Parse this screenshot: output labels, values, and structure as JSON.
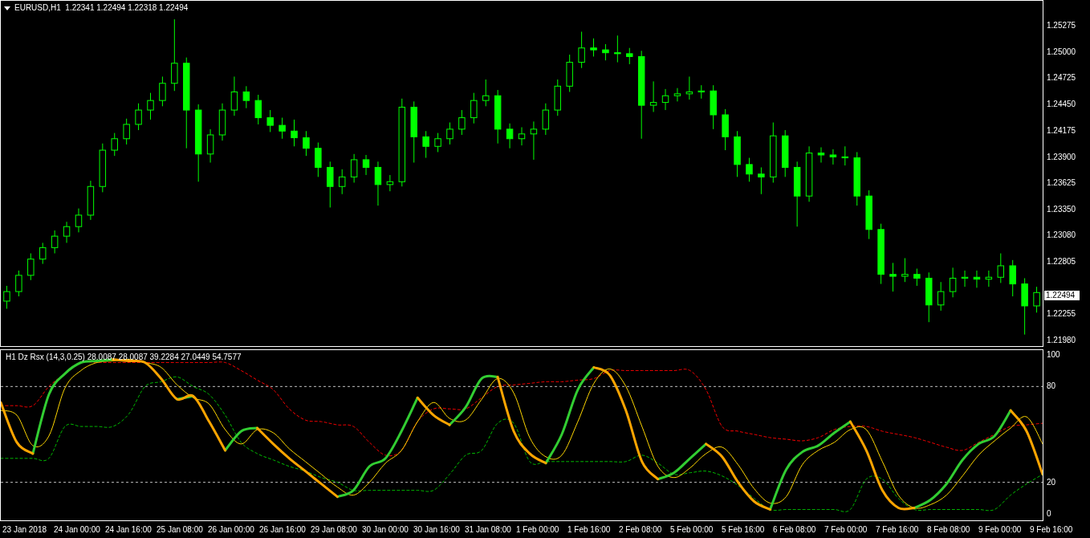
{
  "chart": {
    "title": "EURUSD,H1  1.22341 1.22494 1.22318 1.22494",
    "current_price": "1.22494",
    "chart_data": {
      "type": "candlestick",
      "ylim": [
        1.21921,
        1.25552
      ],
      "yticks": [
        {
          "value": 1.25275,
          "label": "1.25275"
        },
        {
          "value": 1.25,
          "label": "1.25000"
        },
        {
          "value": 1.24725,
          "label": "1.24725"
        },
        {
          "value": 1.2445,
          "label": "1.24450"
        },
        {
          "value": 1.24175,
          "label": "1.24175"
        },
        {
          "value": 1.239,
          "label": "1.23900"
        },
        {
          "value": 1.23625,
          "label": "1.23625"
        },
        {
          "value": 1.2335,
          "label": "1.23350"
        },
        {
          "value": 1.2308,
          "label": "1.23080"
        },
        {
          "value": 1.22805,
          "label": "1.22805"
        },
        {
          "value": 1.22255,
          "label": "1.22255"
        },
        {
          "value": 1.2198,
          "label": "1.21980"
        }
      ],
      "ohlc": [
        [
          1.224,
          1.2256,
          1.2232,
          1.225
        ],
        [
          1.225,
          1.2272,
          1.2245,
          1.2267
        ],
        [
          1.2267,
          1.229,
          1.2262,
          1.2284
        ],
        [
          1.2284,
          1.2301,
          1.2279,
          1.2296
        ],
        [
          1.2296,
          1.2314,
          1.229,
          1.2308
        ],
        [
          1.2308,
          1.2323,
          1.2301,
          1.2318
        ],
        [
          1.2318,
          1.2337,
          1.2312,
          1.233
        ],
        [
          1.233,
          1.2366,
          1.2325,
          1.236
        ],
        [
          1.236,
          1.2405,
          1.2354,
          1.2398
        ],
        [
          1.2398,
          1.2416,
          1.2392,
          1.241
        ],
        [
          1.241,
          1.2431,
          1.2404,
          1.2425
        ],
        [
          1.2425,
          1.2447,
          1.2419,
          1.244
        ],
        [
          1.244,
          1.2458,
          1.243,
          1.245
        ],
        [
          1.245,
          1.2475,
          1.2444,
          1.2468
        ],
        [
          1.2468,
          1.2535,
          1.246,
          1.2489
        ],
        [
          1.2489,
          1.2495,
          1.24,
          1.244
        ],
        [
          1.244,
          1.2446,
          1.2365,
          1.2394
        ],
        [
          1.2394,
          1.242,
          1.2385,
          1.2414
        ],
        [
          1.2414,
          1.2447,
          1.2408,
          1.244
        ],
        [
          1.244,
          1.2475,
          1.2434,
          1.2459
        ],
        [
          1.2459,
          1.2465,
          1.2442,
          1.245
        ],
        [
          1.245,
          1.2456,
          1.2425,
          1.2432
        ],
        [
          1.2432,
          1.244,
          1.2417,
          1.2424
        ],
        [
          1.2424,
          1.2432,
          1.241,
          1.2418
        ],
        [
          1.2418,
          1.243,
          1.2402,
          1.2411
        ],
        [
          1.2411,
          1.2418,
          1.2392,
          1.24
        ],
        [
          1.24,
          1.2406,
          1.237,
          1.238
        ],
        [
          1.238,
          1.2386,
          1.2338,
          1.236
        ],
        [
          1.236,
          1.2378,
          1.2352,
          1.237
        ],
        [
          1.237,
          1.2394,
          1.2364,
          1.2388
        ],
        [
          1.2388,
          1.2393,
          1.2372,
          1.238
        ],
        [
          1.238,
          1.2386,
          1.234,
          1.2362
        ],
        [
          1.2362,
          1.2372,
          1.2355,
          1.2365
        ],
        [
          1.2365,
          1.2452,
          1.236,
          1.2443
        ],
        [
          1.2443,
          1.2449,
          1.2385,
          1.2412
        ],
        [
          1.2412,
          1.2418,
          1.239,
          1.2402
        ],
        [
          1.2402,
          1.2416,
          1.2396,
          1.241
        ],
        [
          1.241,
          1.2427,
          1.2404,
          1.242
        ],
        [
          1.242,
          1.244,
          1.2414,
          1.2432
        ],
        [
          1.2432,
          1.2458,
          1.2426,
          1.245
        ],
        [
          1.245,
          1.2472,
          1.2444,
          1.2455
        ],
        [
          1.2455,
          1.2461,
          1.2405,
          1.242
        ],
        [
          1.242,
          1.2426,
          1.24,
          1.241
        ],
        [
          1.241,
          1.2422,
          1.2403,
          1.2415
        ],
        [
          1.2415,
          1.2428,
          1.2388,
          1.242
        ],
        [
          1.242,
          1.2447,
          1.2414,
          1.244
        ],
        [
          1.244,
          1.2472,
          1.2434,
          1.2465
        ],
        [
          1.2465,
          1.2498,
          1.2459,
          1.249
        ],
        [
          1.249,
          1.2522,
          1.2484,
          1.2505
        ],
        [
          1.2505,
          1.2515,
          1.2496,
          1.2503
        ],
        [
          1.2503,
          1.2509,
          1.2492,
          1.25
        ],
        [
          1.25,
          1.2518,
          1.249,
          1.2499
        ],
        [
          1.2499,
          1.2505,
          1.2488,
          1.2496
        ],
        [
          1.2496,
          1.2502,
          1.241,
          1.2445
        ],
        [
          1.2445,
          1.247,
          1.2438,
          1.2448
        ],
        [
          1.2448,
          1.2462,
          1.244,
          1.2455
        ],
        [
          1.2455,
          1.2463,
          1.2449,
          1.2457
        ],
        [
          1.2457,
          1.2475,
          1.2451,
          1.2459
        ],
        [
          1.2459,
          1.2466,
          1.2452,
          1.246
        ],
        [
          1.246,
          1.2466,
          1.242,
          1.2435
        ],
        [
          1.2435,
          1.2441,
          1.2398,
          1.2412
        ],
        [
          1.2412,
          1.2418,
          1.237,
          1.2383
        ],
        [
          1.2383,
          1.239,
          1.2365,
          1.2373
        ],
        [
          1.2373,
          1.238,
          1.2352,
          1.237
        ],
        [
          1.237,
          1.2427,
          1.2364,
          1.2413
        ],
        [
          1.2413,
          1.2419,
          1.237,
          1.238
        ],
        [
          1.238,
          1.2386,
          1.2318,
          1.235
        ],
        [
          1.235,
          1.2402,
          1.2344,
          1.2395
        ],
        [
          1.2395,
          1.2401,
          1.2385,
          1.2393
        ],
        [
          1.2393,
          1.2399,
          1.2383,
          1.2391
        ],
        [
          1.2391,
          1.2402,
          1.2382,
          1.239
        ],
        [
          1.239,
          1.2396,
          1.234,
          1.235
        ],
        [
          1.235,
          1.2356,
          1.2305,
          1.2315
        ],
        [
          1.2315,
          1.2321,
          1.2258,
          1.2268
        ],
        [
          1.2268,
          1.228,
          1.225,
          1.2266
        ],
        [
          1.2266,
          1.2285,
          1.226,
          1.2268
        ],
        [
          1.2268,
          1.2274,
          1.2256,
          1.2264
        ],
        [
          1.2264,
          1.227,
          1.2218,
          1.2236
        ],
        [
          1.2236,
          1.226,
          1.223,
          1.225
        ],
        [
          1.225,
          1.2275,
          1.2244,
          1.2264
        ],
        [
          1.2264,
          1.2272,
          1.2255,
          1.2265
        ],
        [
          1.2265,
          1.2272,
          1.2254,
          1.2263
        ],
        [
          1.2263,
          1.2272,
          1.2255,
          1.2265
        ],
        [
          1.2265,
          1.229,
          1.2259,
          1.2277
        ],
        [
          1.2277,
          1.2283,
          1.2245,
          1.2258
        ],
        [
          1.2258,
          1.2264,
          1.2205,
          1.2235
        ],
        [
          1.2235,
          1.2255,
          1.2228,
          1.2249
        ]
      ]
    }
  },
  "indicator": {
    "title": "H1 Dz Rsx (14,3,0.25) 28.0087 28.0087 39.2284 27.0449 54.7577",
    "chart_data": {
      "type": "line",
      "ylim": [
        -4.3,
        103.3
      ],
      "yticks": [
        100,
        80,
        20,
        0
      ],
      "series": [
        {
          "color": "#ff0000",
          "line_style": "dashed",
          "values": [
            68,
            68,
            68,
            80,
            88,
            95,
            95,
            95,
            95,
            95,
            95,
            95,
            95,
            95,
            95,
            90,
            84,
            78,
            66,
            59,
            58,
            56,
            55,
            45,
            37,
            40,
            58,
            66,
            66,
            66,
            73,
            80,
            81,
            82,
            83,
            83,
            84,
            85,
            90,
            90,
            90,
            90,
            90,
            90,
            78,
            55,
            52,
            50,
            48,
            47,
            46,
            48,
            53,
            55,
            55,
            52,
            50,
            48,
            45,
            42,
            40,
            45,
            50,
            55,
            56,
            57
          ]
        },
        {
          "color": "#00c000",
          "line_style": "dashed",
          "values": [
            35,
            35,
            35,
            35,
            55,
            55,
            55,
            55,
            63,
            80,
            83,
            86,
            80,
            75,
            62,
            45,
            38,
            34,
            30,
            27,
            23,
            20,
            15,
            15,
            15,
            15,
            15,
            15,
            25,
            37,
            40,
            57,
            57,
            33,
            33,
            33,
            33,
            33,
            33,
            33,
            37,
            32,
            25,
            26,
            27,
            24,
            18,
            10,
            3,
            3,
            3,
            3,
            3,
            3,
            22,
            22,
            10,
            3,
            3,
            3,
            3,
            3,
            3,
            12,
            19,
            25
          ]
        },
        {
          "color": "#ffd700",
          "line_style": "solid",
          "values": [
            65,
            62,
            43,
            49,
            79,
            90,
            95,
            96,
            97,
            95,
            92,
            81,
            73,
            69,
            53,
            44,
            53,
            51,
            41,
            33,
            25,
            17,
            12,
            20,
            32,
            40,
            58,
            70,
            60,
            59,
            72,
            85,
            76,
            48,
            36,
            37,
            58,
            82,
            91,
            80,
            55,
            30,
            23,
            29,
            38,
            42,
            31,
            16,
            7,
            11,
            31,
            40,
            45,
            53,
            53,
            33,
            12,
            4,
            6,
            12,
            24,
            37,
            46,
            54,
            61,
            44
          ]
        },
        {
          "color": "#32cd32",
          "line_style": "solid",
          "values": [
            null,
            null,
            38,
            75,
            88,
            95,
            96,
            97,
            null,
            null,
            null,
            72,
            74,
            null,
            40,
            52,
            54,
            null,
            null,
            null,
            null,
            11,
            15,
            30,
            35,
            52,
            73,
            null,
            56,
            67,
            85,
            86,
            null,
            null,
            32,
            50,
            78,
            92,
            null,
            null,
            null,
            22,
            26,
            35,
            44,
            null,
            null,
            null,
            3,
            28,
            39,
            43,
            51,
            58,
            null,
            null,
            null,
            4,
            9,
            19,
            34,
            44,
            49,
            65,
            null,
            null
          ]
        },
        {
          "color": "#ffa500",
          "line_style": "solid",
          "values": [
            70,
            45,
            38,
            null,
            null,
            null,
            null,
            97,
            96,
            95,
            85,
            72,
            74,
            58,
            40,
            null,
            54,
            44,
            35,
            27,
            19,
            11,
            null,
            null,
            null,
            null,
            73,
            62,
            56,
            null,
            null,
            86,
            52,
            38,
            32,
            null,
            null,
            92,
            87,
            65,
            33,
            22,
            null,
            null,
            44,
            36,
            20,
            8,
            3,
            null,
            null,
            null,
            null,
            58,
            40,
            15,
            4,
            4,
            null,
            null,
            null,
            null,
            null,
            65,
            52,
            25
          ]
        }
      ]
    }
  },
  "time_axis": [
    "23 Jan 2018",
    "24 Jan 00:00",
    "24 Jan 16:00",
    "25 Jan 08:00",
    "26 Jan 00:00",
    "26 Jan 16:00",
    "29 Jan 08:00",
    "30 Jan 00:00",
    "30 Jan 16:00",
    "31 Jan 08:00",
    "1 Feb 00:00",
    "1 Feb 16:00",
    "2 Feb 08:00",
    "5 Feb 00:00",
    "5 Feb 16:00",
    "6 Feb 08:00",
    "7 Feb 00:00",
    "7 Feb 16:00",
    "8 Feb 08:00",
    "9 Feb 00:00",
    "9 Feb 16:00"
  ]
}
